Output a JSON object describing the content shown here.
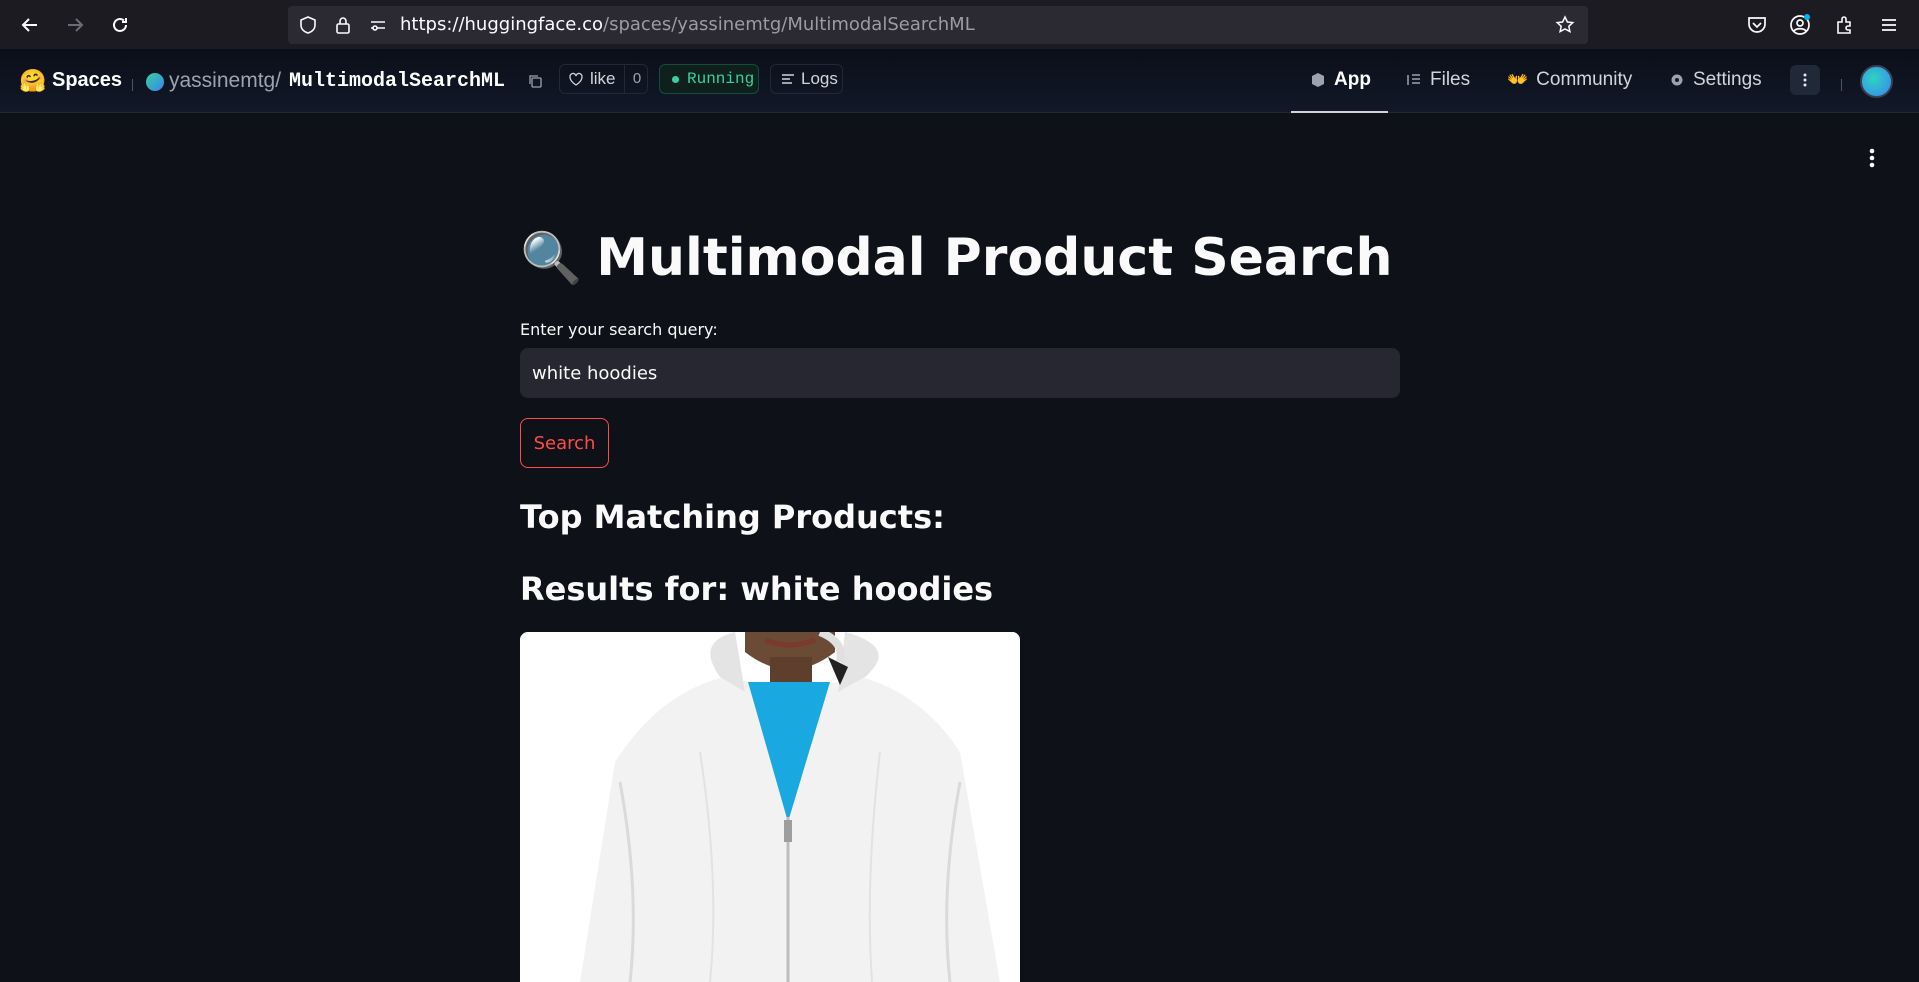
{
  "browser": {
    "url_host": "https://huggingface.co",
    "url_path": "/spaces/yassinemtg/MultimodalSearchML"
  },
  "header": {
    "brand": "Spaces",
    "owner": "yassinemtg",
    "separator": "/",
    "repo": "MultimodalSearchML",
    "like_label": "like",
    "like_count": "0",
    "status": "Running",
    "logs_label": "Logs",
    "tabs": [
      {
        "label": "App",
        "icon": "cube-icon"
      },
      {
        "label": "Files",
        "icon": "files-icon"
      },
      {
        "label": "Community",
        "icon": "community-icon"
      },
      {
        "label": "Settings",
        "icon": "gear-icon"
      }
    ]
  },
  "app": {
    "title": "Multimodal Product Search",
    "title_emoji": "🔍",
    "query_label": "Enter your search query:",
    "query_value": "white hoodies",
    "search_button": "Search",
    "top_heading": "Top Matching Products:",
    "results_heading": "Results for: white hoodies"
  },
  "colors": {
    "background": "#0e1117",
    "accent": "#ff4b4b",
    "running": "#34d399"
  }
}
